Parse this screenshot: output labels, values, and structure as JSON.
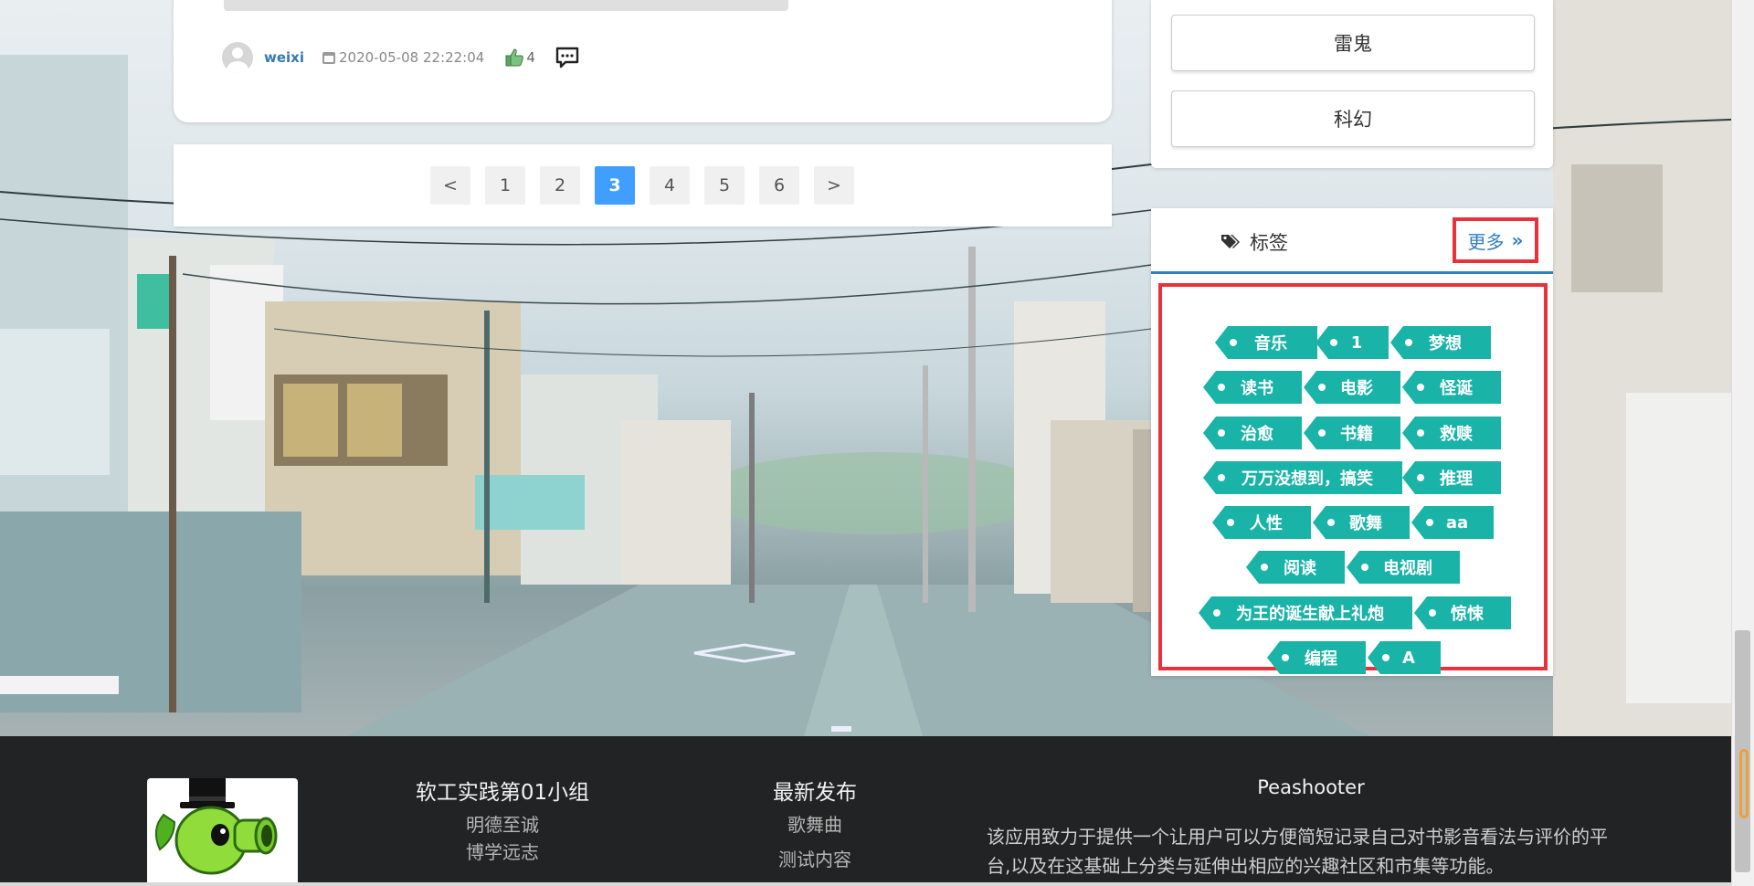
{
  "post": {
    "author": "weixi",
    "date": "2020-05-08 22:22:04",
    "likes": "4"
  },
  "pagination": {
    "prev": "<",
    "next": ">",
    "pages": [
      "1",
      "2",
      "3",
      "4",
      "5",
      "6"
    ],
    "current": "3"
  },
  "categories": [
    "雷鬼",
    "科幻"
  ],
  "tags_panel": {
    "title": "标签",
    "more": "更多",
    "more_icon": "»",
    "tags": [
      "音乐",
      "1",
      "梦想",
      "读书",
      "电影",
      "怪诞",
      "治愈",
      "书籍",
      "救赎",
      "万万没想到，搞笑",
      "推理",
      "人性",
      "歌舞",
      "aa",
      "阅读",
      "电视剧",
      "为王的诞生献上礼炮",
      "惊悚",
      "编程",
      "A"
    ]
  },
  "footer": {
    "group_title": "软工实践第01小组",
    "group_links": [
      "明德至诚",
      "博学远志"
    ],
    "latest_title": "最新发布",
    "latest_links": [
      "歌舞曲",
      "测试内容"
    ],
    "app_title": "Peashooter",
    "app_desc": "该应用致力于提供一个让用户可以方便简短记录自己对书影音看法与评价的平台,以及在这基础上分类与延伸出相应的兴趣社区和市集等功能。"
  },
  "colors": {
    "tag_bg": "#19b3a8",
    "active_page": "#409eff",
    "link_blue": "#2f7fc1",
    "highlight_red": "#e8313a",
    "footer_bg": "#222324"
  }
}
